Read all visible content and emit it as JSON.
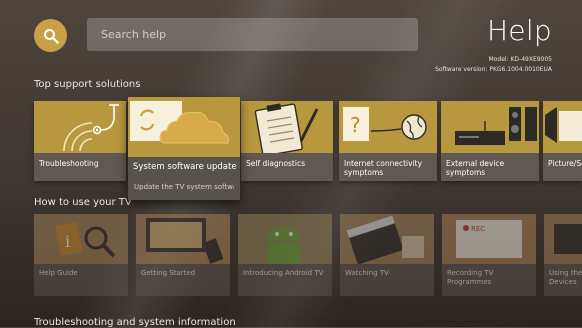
{
  "header": {
    "title": "Help",
    "search_placeholder": "Search help",
    "model_label": "Model: KD-49XE9005",
    "software_label": "Software version: PKG6.1004.0010EUA"
  },
  "sections": {
    "top_support": "Top support solutions",
    "how_to_use": "How to use your TV",
    "troubleshooting_info": "Troubleshooting and system information"
  },
  "top_cards": [
    {
      "label": "Troubleshooting",
      "icon": "stethoscope-icon"
    },
    {
      "label": "System software update",
      "description": "Update the TV system softwar",
      "icon": "cloud-update-icon"
    },
    {
      "label": "Self diagnostics",
      "icon": "clipboard-icon"
    },
    {
      "label": "Internet connectivity symptoms",
      "icon": "question-globe-icon"
    },
    {
      "label": "External device symptoms",
      "icon": "devices-icon"
    },
    {
      "label": "Picture/Sc",
      "icon": "picture-icon"
    }
  ],
  "howto_cards": [
    {
      "label": "Help Guide",
      "icon": "help-guide-icon"
    },
    {
      "label": "Getting Started",
      "icon": "remote-icon"
    },
    {
      "label": "Introducing Android TV",
      "icon": "android-icon"
    },
    {
      "label": "Watching TV",
      "icon": "clapper-icon"
    },
    {
      "label": "Recording TV Programmes",
      "icon": "rec-icon"
    },
    {
      "label": "Using the Devices",
      "icon": "device-icon"
    }
  ],
  "colors": {
    "accent": "#c8a045",
    "thumb_gold": "#b8983e",
    "card": "#5f5853"
  }
}
